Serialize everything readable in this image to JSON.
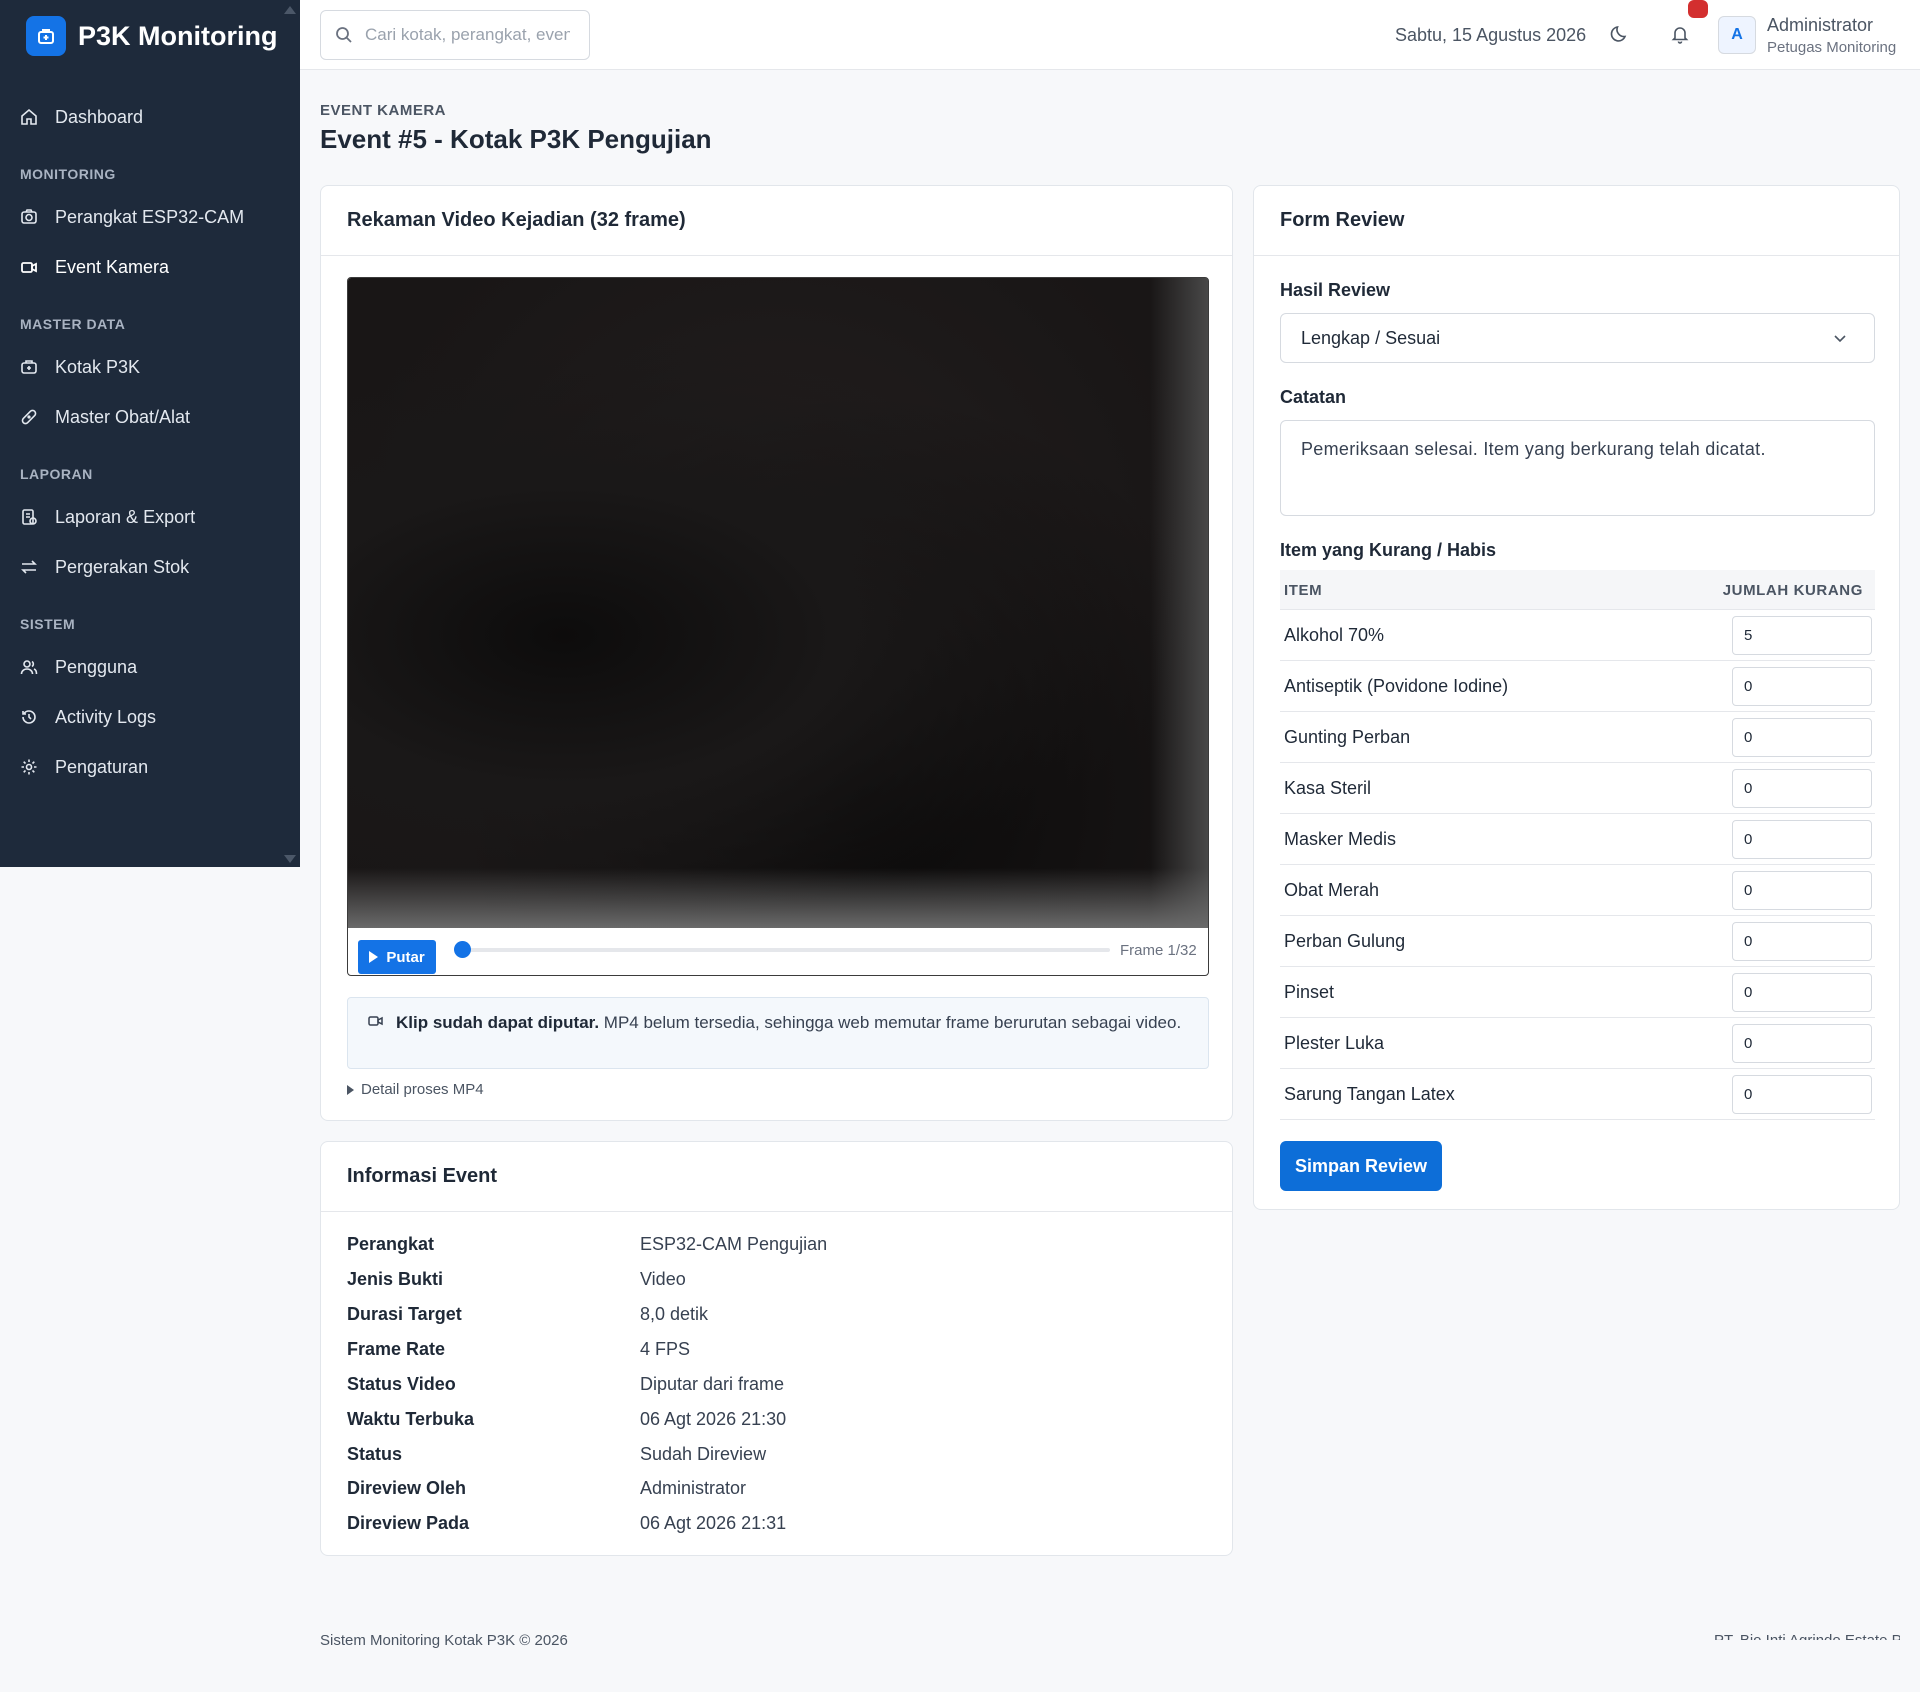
{
  "brand": {
    "title": "P3K Monitoring",
    "icon": "first-aid-kit-icon"
  },
  "sidebar": {
    "dashboard": {
      "label": "Dashboard",
      "icon": "home-icon"
    },
    "sections": [
      {
        "title": "MONITORING",
        "items": [
          {
            "label": "Perangkat ESP32-CAM",
            "icon": "camera-icon"
          },
          {
            "label": "Event Kamera",
            "icon": "video-camera-icon",
            "active": true
          }
        ]
      },
      {
        "title": "MASTER DATA",
        "items": [
          {
            "label": "Kotak P3K",
            "icon": "first-aid-kit-icon"
          },
          {
            "label": "Master Obat/Alat",
            "icon": "bandage-icon"
          }
        ]
      },
      {
        "title": "LAPORAN",
        "items": [
          {
            "label": "Laporan & Export",
            "icon": "report-icon"
          },
          {
            "label": "Pergerakan Stok",
            "icon": "arrows-swap-icon"
          }
        ]
      },
      {
        "title": "SISTEM",
        "items": [
          {
            "label": "Pengguna",
            "icon": "users-icon"
          },
          {
            "label": "Activity Logs",
            "icon": "history-icon"
          },
          {
            "label": "Pengaturan",
            "icon": "gear-icon"
          }
        ]
      }
    ]
  },
  "topbar": {
    "search_placeholder": "Cari kotak, perangkat, event",
    "date": "Sabtu, 15 Agustus 2026",
    "user_initial": "A",
    "user_name": "Administrator",
    "user_role": "Petugas Monitoring"
  },
  "page": {
    "eyebrow": "EVENT KAMERA",
    "title": "Event #5 - Kotak P3K Pengujian"
  },
  "video": {
    "card_title": "Rekaman Video Kejadian (32 frame)",
    "play_label": "Putar",
    "frame_label": "Frame 1/32",
    "progress_fraction": 0.0,
    "note_bold": "Klip sudah dapat diputar.",
    "note_text": " MP4 belum tersedia, sehingga web memutar frame berurutan sebagai video.",
    "detail_toggle": "Detail proses MP4"
  },
  "info": {
    "card_title": "Informasi Event",
    "rows": [
      {
        "label": "Perangkat",
        "value": "ESP32-CAM Pengujian"
      },
      {
        "label": "Jenis Bukti",
        "value": "Video"
      },
      {
        "label": "Durasi Target",
        "value": "8,0 detik"
      },
      {
        "label": "Frame Rate",
        "value": "4 FPS"
      },
      {
        "label": "Status Video",
        "value": "Diputar dari frame"
      },
      {
        "label": "Waktu Terbuka",
        "value": "06 Agt 2026 21:30"
      },
      {
        "label": "Status",
        "value": "Sudah Direview"
      },
      {
        "label": "Direview Oleh",
        "value": "Administrator"
      },
      {
        "label": "Direview Pada",
        "value": "06 Agt 2026 21:31"
      }
    ]
  },
  "review": {
    "card_title": "Form Review",
    "result_label": "Hasil Review",
    "result_value": "Lengkap / Sesuai",
    "notes_label": "Catatan",
    "notes_value": "Pemeriksaan selesai. Item yang berkurang telah dicatat.",
    "items_label": "Item yang Kurang / Habis",
    "col_item": "ITEM",
    "col_qty": "JUMLAH KURANG",
    "items": [
      {
        "name": "Alkohol 70%",
        "qty": "5"
      },
      {
        "name": "Antiseptik (Povidone Iodine)",
        "qty": "0"
      },
      {
        "name": "Gunting Perban",
        "qty": "0"
      },
      {
        "name": "Kasa Steril",
        "qty": "0"
      },
      {
        "name": "Masker Medis",
        "qty": "0"
      },
      {
        "name": "Obat Merah",
        "qty": "0"
      },
      {
        "name": "Perban Gulung",
        "qty": "0"
      },
      {
        "name": "Pinset",
        "qty": "0"
      },
      {
        "name": "Plester Luka",
        "qty": "0"
      },
      {
        "name": "Sarung Tangan Latex",
        "qty": "0"
      }
    ],
    "save_label": "Simpan Review"
  },
  "footer": {
    "left": "Sistem Monitoring Kotak P3K © 2026",
    "right": "PT. Bio Inti Agrindo Estate P"
  },
  "colors": {
    "sidebar_bg": "#1e2a3b",
    "accent": "#1473e6",
    "notification": "#d32f2f"
  }
}
